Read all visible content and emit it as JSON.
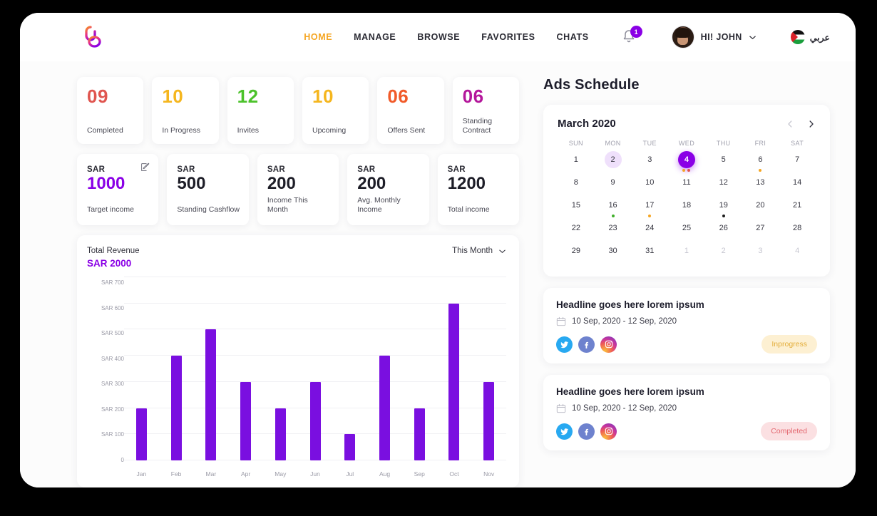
{
  "header": {
    "logo_icon": "brand-logo-icon",
    "nav": [
      {
        "label": "HOME",
        "active": true
      },
      {
        "label": "MANAGE",
        "active": false
      },
      {
        "label": "BROWSE",
        "active": false
      },
      {
        "label": "FAVORITES",
        "active": false
      },
      {
        "label": "CHATS",
        "active": false
      }
    ],
    "notification_icon": "bell-icon",
    "notification_count": "1",
    "avatar_icon": "user-avatar",
    "username": "HI! JOHN",
    "user_chevron_icon": "chevron-down-icon",
    "flag_icon": "palestine-flag-icon",
    "language": "عربي"
  },
  "stats": [
    {
      "value": "09",
      "label": "Completed",
      "color": "#E0554F"
    },
    {
      "value": "10",
      "label": "In Progress",
      "color": "#F5B61E"
    },
    {
      "value": "12",
      "label": "Invites",
      "color": "#4CC22B"
    },
    {
      "value": "10",
      "label": "Upcoming",
      "color": "#F5B61E"
    },
    {
      "value": "06",
      "label": "Offers Sent",
      "color": "#F15A29"
    },
    {
      "value": "06",
      "label": "Standing Contract",
      "color": "#B4179B"
    }
  ],
  "finances": [
    {
      "currency": "SAR",
      "value": "1000",
      "label": "Target income",
      "accent": true,
      "edit_icon": "edit-pencil-icon"
    },
    {
      "currency": "SAR",
      "value": "500",
      "label": "Standing Cashflow",
      "accent": false
    },
    {
      "currency": "SAR",
      "value": "200",
      "label": "Income This Month",
      "accent": false
    },
    {
      "currency": "SAR",
      "value": "200",
      "label": "Avg. Monthly Income",
      "accent": false
    },
    {
      "currency": "SAR",
      "value": "1200",
      "label": "Total income",
      "accent": false
    }
  ],
  "chart_panel": {
    "title": "Total Revenue",
    "amount": "SAR 2000",
    "range_selected": "This Month",
    "range_chevron_icon": "chevron-down-icon"
  },
  "chart_data": {
    "type": "bar",
    "title": "Total Revenue",
    "subtitle": "SAR 2000",
    "categories": [
      "Jan",
      "Feb",
      "Mar",
      "Apr",
      "May",
      "Jun",
      "Jul",
      "Aug",
      "Sep",
      "Oct",
      "Nov"
    ],
    "values": [
      200,
      400,
      500,
      300,
      200,
      300,
      100,
      400,
      200,
      600,
      300
    ],
    "ytick_labels": [
      "0",
      "SAR 100",
      "SAR 200",
      "SAR 300",
      "SAR 400",
      "SAR 500",
      "SAR 600",
      "SAR 700"
    ],
    "ytick_values": [
      0,
      100,
      200,
      300,
      400,
      500,
      600,
      700
    ],
    "ylim": [
      0,
      700
    ],
    "xlabel": "",
    "ylabel": "",
    "grid": true,
    "legend": "none",
    "bar_color": "#7A0FE0"
  },
  "ads": {
    "section_title": "Ads Schedule",
    "calendar": {
      "month": "March 2020",
      "prev_icon": "chevron-left-icon",
      "next_icon": "chevron-right-icon",
      "weekdays": [
        "SUN",
        "MON",
        "TUE",
        "WED",
        "THU",
        "FRI",
        "SAT"
      ],
      "days": [
        {
          "n": "1"
        },
        {
          "n": "2",
          "state": "soft"
        },
        {
          "n": "3"
        },
        {
          "n": "4",
          "state": "sel",
          "dots": [
            "#F5A623",
            "#E0554F"
          ]
        },
        {
          "n": "5"
        },
        {
          "n": "6",
          "dots": [
            "#F5A623"
          ]
        },
        {
          "n": "7"
        },
        {
          "n": "8"
        },
        {
          "n": "9"
        },
        {
          "n": "10"
        },
        {
          "n": "11"
        },
        {
          "n": "12"
        },
        {
          "n": "13"
        },
        {
          "n": "14"
        },
        {
          "n": "15"
        },
        {
          "n": "16",
          "dots": [
            "#3FAE29"
          ]
        },
        {
          "n": "17",
          "dots": [
            "#F5A623"
          ]
        },
        {
          "n": "18"
        },
        {
          "n": "19",
          "dots": [
            "#1b1b1b"
          ]
        },
        {
          "n": "20"
        },
        {
          "n": "21"
        },
        {
          "n": "22"
        },
        {
          "n": "23"
        },
        {
          "n": "24"
        },
        {
          "n": "25"
        },
        {
          "n": "26"
        },
        {
          "n": "27"
        },
        {
          "n": "28"
        },
        {
          "n": "29"
        },
        {
          "n": "30"
        },
        {
          "n": "31"
        },
        {
          "n": "1",
          "state": "muted"
        },
        {
          "n": "2",
          "state": "muted"
        },
        {
          "n": "3",
          "state": "muted"
        },
        {
          "n": "4",
          "state": "muted"
        }
      ]
    },
    "cards": [
      {
        "headline": "Headline goes here lorem ipsum",
        "calendar_icon": "calendar-icon",
        "date_range": "10 Sep, 2020  -  12 Sep, 2020",
        "socials": [
          "twitter-icon",
          "facebook-icon",
          "instagram-icon"
        ],
        "status": "Inprogress",
        "status_kind": "inprogress"
      },
      {
        "headline": "Headline goes here lorem ipsum",
        "calendar_icon": "calendar-icon",
        "date_range": "10 Sep, 2020  -  12 Sep, 2020",
        "socials": [
          "twitter-icon",
          "facebook-icon",
          "instagram-icon"
        ],
        "status": "Completed",
        "status_kind": "completed"
      }
    ]
  }
}
